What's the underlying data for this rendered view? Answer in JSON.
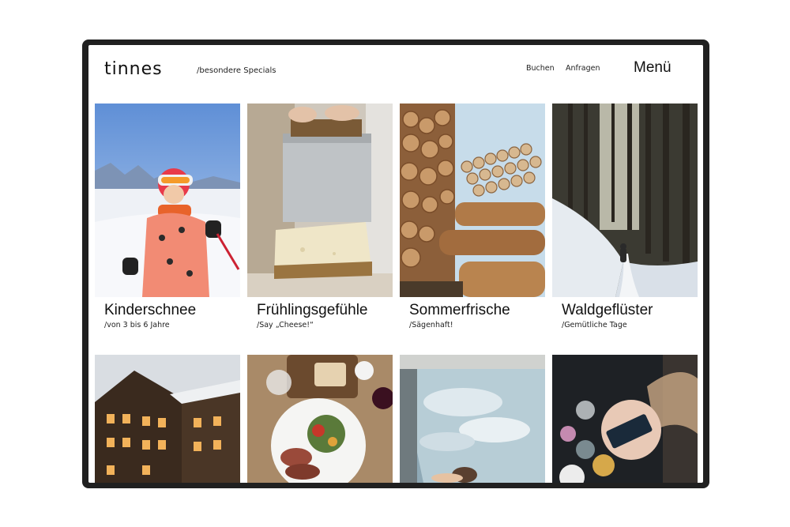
{
  "header": {
    "logo": "tinnes",
    "subnav": "/besondere Specials",
    "nav": {
      "book": "Buchen",
      "inquire": "Anfragen"
    },
    "menu": "Menü"
  },
  "cards": [
    {
      "title": "Kinderschnee",
      "subtitle": "/von 3 bis 6 Jahre"
    },
    {
      "title": "Frühlingsgefühle",
      "subtitle": "/Say „Cheese!“"
    },
    {
      "title": "Sommerfrische",
      "subtitle": "/Sägenhaft!"
    },
    {
      "title": "Waldgeflüster",
      "subtitle": "/Gemütliche Tage"
    }
  ],
  "colors": {
    "device_frame": "#202020",
    "background": "#ffffff",
    "text": "#111111"
  }
}
